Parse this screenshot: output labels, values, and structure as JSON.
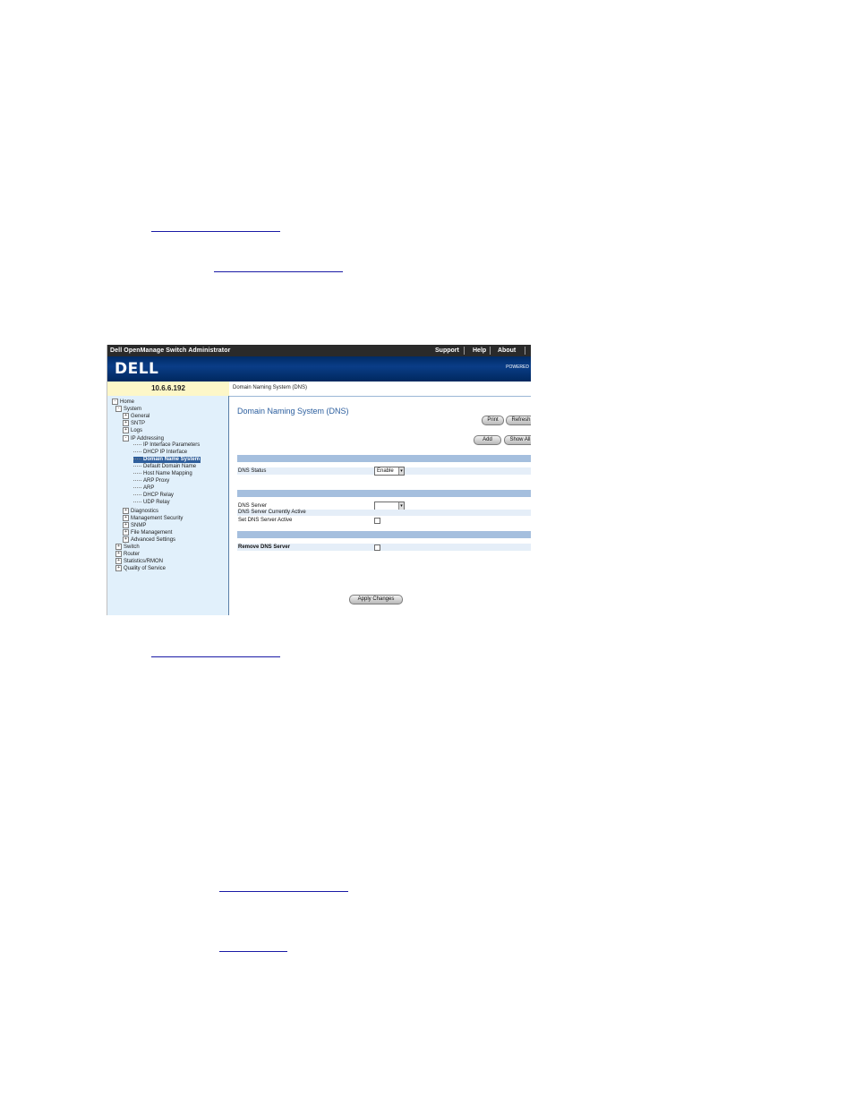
{
  "document": {
    "links": [
      "",
      "",
      "",
      "",
      ""
    ]
  },
  "app": {
    "title": "Dell OpenManage Switch Administrator",
    "top_links": [
      "Support",
      "Help",
      "About"
    ],
    "logo": "DELL",
    "powered_text": "POWERED",
    "ip_address": "10.6.6.192",
    "page_tab": "Domain Naming System (DNS)"
  },
  "tree": [
    {
      "label": "Home",
      "level": 0,
      "control": "-"
    },
    {
      "label": "System",
      "level": 1,
      "control": "-"
    },
    {
      "label": "General",
      "level": 2,
      "control": "+"
    },
    {
      "label": "SNTP",
      "level": 2,
      "control": "+"
    },
    {
      "label": "Logs",
      "level": 2,
      "control": "+"
    },
    {
      "label": "IP Addressing",
      "level": 2,
      "control": "-"
    },
    {
      "label": "IP Interface Parameters",
      "level": 3,
      "control": ""
    },
    {
      "label": "DHCP IP Interface",
      "level": 3,
      "control": ""
    },
    {
      "label": "Domain Name System",
      "level": 3,
      "control": "",
      "selected": true
    },
    {
      "label": "Default Domain Name",
      "level": 3,
      "control": ""
    },
    {
      "label": "Host Name Mapping",
      "level": 3,
      "control": ""
    },
    {
      "label": "ARP Proxy",
      "level": 3,
      "control": ""
    },
    {
      "label": "ARP",
      "level": 3,
      "control": ""
    },
    {
      "label": "DHCP Relay",
      "level": 3,
      "control": ""
    },
    {
      "label": "UDP Relay",
      "level": 3,
      "control": ""
    },
    {
      "label": "Diagnostics",
      "level": 2,
      "control": "+"
    },
    {
      "label": "Management Security",
      "level": 2,
      "control": "+"
    },
    {
      "label": "SNMP",
      "level": 2,
      "control": "+"
    },
    {
      "label": "File Management",
      "level": 2,
      "control": "+"
    },
    {
      "label": "Advanced Settings",
      "level": 2,
      "control": "+"
    },
    {
      "label": "Switch",
      "level": 1,
      "control": "+"
    },
    {
      "label": "Router",
      "level": 1,
      "control": "+"
    },
    {
      "label": "Statistics/RMON",
      "level": 1,
      "control": "+"
    },
    {
      "label": "Quality of Service",
      "level": 1,
      "control": "+"
    }
  ],
  "content": {
    "title": "Domain Naming System (DNS)",
    "buttons": {
      "print": "Print",
      "refresh": "Refresh",
      "add": "Add",
      "show_all": "Show All",
      "apply": "Apply Changes"
    },
    "dns_status": {
      "label": "DNS Status",
      "value": "Enable"
    },
    "dns_server": {
      "label": "DNS Server",
      "value": ""
    },
    "current_active": {
      "label": "DNS Server Currently Active"
    },
    "set_active": {
      "label": "Set DNS Server Active"
    },
    "remove_server": {
      "label": "Remove DNS Server"
    }
  }
}
